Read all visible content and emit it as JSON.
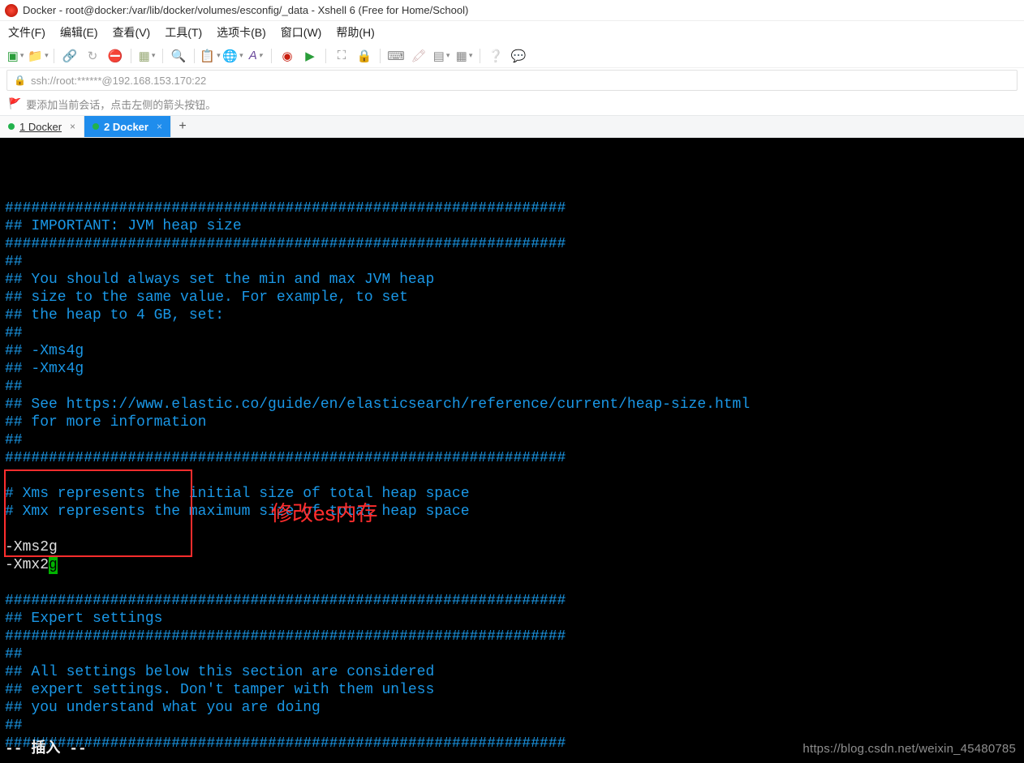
{
  "window": {
    "title": "Docker - root@docker:/var/lib/docker/volumes/esconfig/_data - Xshell 6 (Free for Home/School)"
  },
  "menu": {
    "file": "文件(F)",
    "edit": "编辑(E)",
    "view": "查看(V)",
    "tools": "工具(T)",
    "tabs": "选项卡(B)",
    "window": "窗口(W)",
    "help": "帮助(H)"
  },
  "addressbar": {
    "url": "ssh://root:******@192.168.153.170:22"
  },
  "hint": {
    "text": "要添加当前会话，点击左侧的箭头按钮。"
  },
  "tabs": {
    "t1": "1 Docker",
    "t2": "2 Docker"
  },
  "newtab": "+",
  "terminal": {
    "lines": [
      "",
      "################################################################",
      "## IMPORTANT: JVM heap size",
      "################################################################",
      "##",
      "## You should always set the min and max JVM heap",
      "## size to the same value. For example, to set",
      "## the heap to 4 GB, set:",
      "##",
      "## -Xms4g",
      "## -Xmx4g",
      "##",
      "## See https://www.elastic.co/guide/en/elasticsearch/reference/current/heap-size.html",
      "## for more information",
      "##",
      "################################################################",
      "",
      "# Xms represents the initial size of total heap space",
      "# Xmx represents the maximum size of total heap space",
      "",
      "-Xms2g",
      "-Xmx2",
      "",
      "################################################################",
      "## Expert settings",
      "################################################################",
      "##",
      "## All settings below this section are considered",
      "## expert settings. Don't tamper with them unless",
      "## you understand what you are doing",
      "##",
      "################################################################"
    ],
    "cursor_char": "g",
    "mode": "-- 插入 --"
  },
  "annotation": {
    "label": "修改es内存"
  },
  "watermark": {
    "text": "https://blog.csdn.net/weixin_45480785"
  }
}
